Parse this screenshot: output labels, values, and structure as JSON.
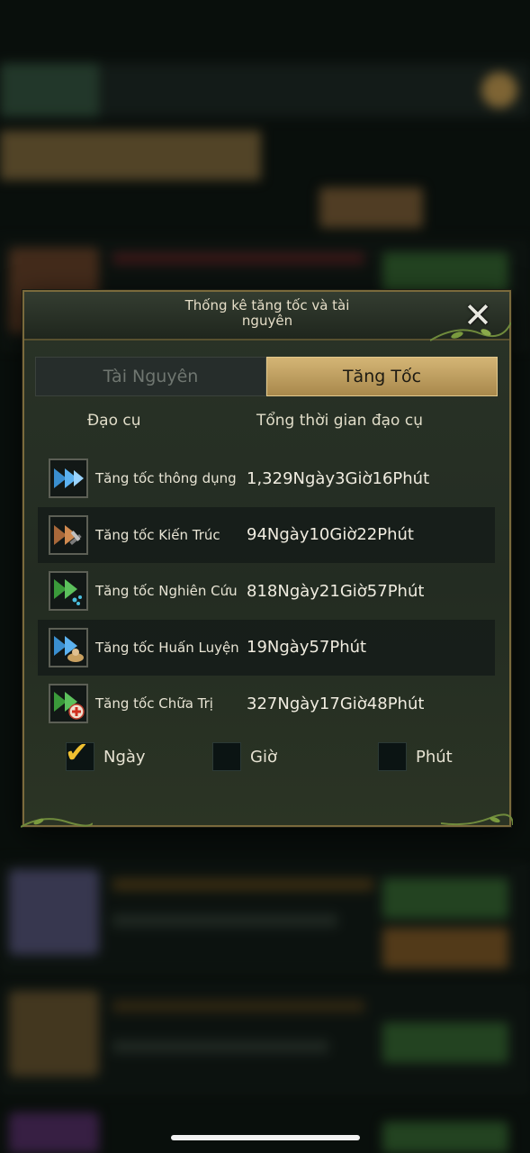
{
  "dialog": {
    "title": "Thống kê tăng tốc và tài nguyên",
    "close_icon": "close-x-icon"
  },
  "tabs": [
    {
      "label": "Tài Nguyên",
      "active": false
    },
    {
      "label": "Tăng Tốc",
      "active": true
    }
  ],
  "table": {
    "headers": {
      "item": "Đạo cụ",
      "time": "Tổng thời gian đạo cụ"
    },
    "rows": [
      {
        "icon": "general-speedup-icon",
        "name": "Tăng tốc thông dụng",
        "time": "1,329Ngày3Giờ16Phút"
      },
      {
        "icon": "construction-speedup-icon",
        "name": "Tăng tốc Kiến Trúc",
        "time": "94Ngày10Giờ22Phút"
      },
      {
        "icon": "research-speedup-icon",
        "name": "Tăng tốc Nghiên Cứu",
        "time": "818Ngày21Giờ57Phút"
      },
      {
        "icon": "training-speedup-icon",
        "name": "Tăng tốc Huấn Luyện",
        "time": "19Ngày57Phút"
      },
      {
        "icon": "healing-speedup-icon",
        "name": "Tăng tốc Chữa Trị",
        "time": "327Ngày17Giờ48Phút"
      }
    ]
  },
  "units": [
    {
      "label": "Ngày",
      "checked": true
    },
    {
      "label": "Giờ",
      "checked": false
    },
    {
      "label": "Phút",
      "checked": false
    }
  ],
  "colors": {
    "accent_gold": "#c8a865",
    "check_yellow": "#f0c030",
    "panel": "#242d23"
  }
}
